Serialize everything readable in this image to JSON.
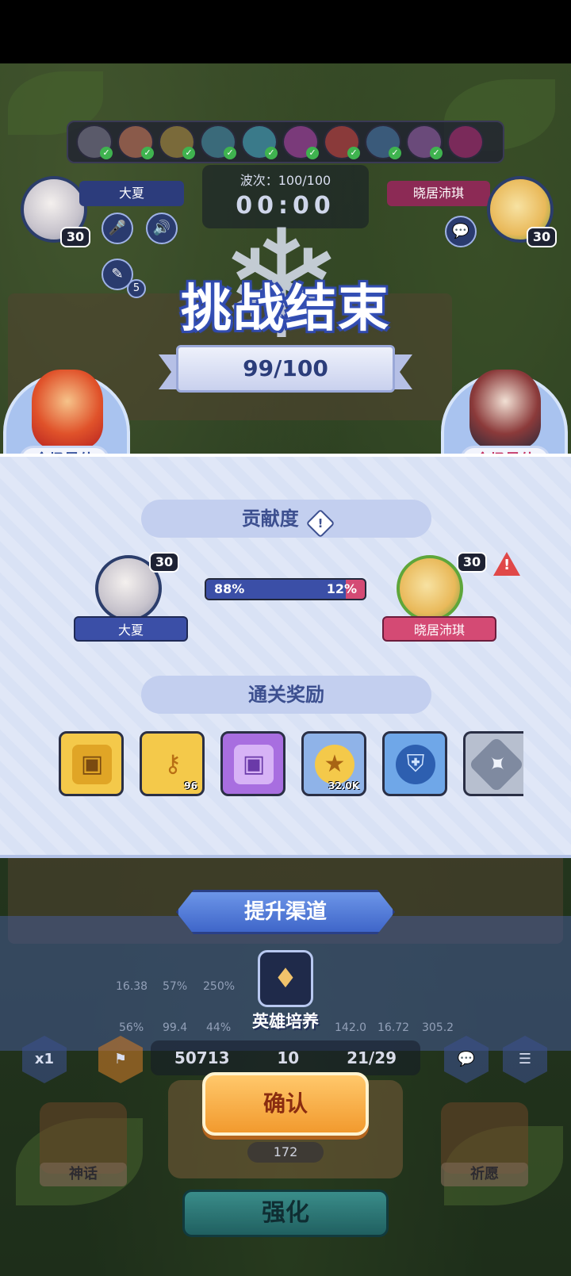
{
  "hud": {
    "player_left": {
      "name": "大夏",
      "level": "30"
    },
    "player_right": {
      "name": "晓居沛琪",
      "level": "30"
    },
    "wave_label": "波次：100/100",
    "timer": "00:00",
    "notes_count": "5"
  },
  "result": {
    "title": "挑战结束",
    "score": "99/100",
    "mvp_left": "全场最佳",
    "mvp_right": "全场最佳"
  },
  "contribution": {
    "header": "贡献度",
    "info_icon": "!",
    "left": {
      "name": "大夏",
      "level": "30",
      "percent_label": "88%",
      "percent": 88
    },
    "right": {
      "name": "晓居沛琪",
      "level": "30",
      "percent_label": "12%",
      "percent": 12
    },
    "warning_icon": "!"
  },
  "rewards": {
    "header": "通关奖励",
    "items": [
      {
        "icon": "gold-chest-icon",
        "qty": ""
      },
      {
        "icon": "key-icon",
        "qty": "96"
      },
      {
        "icon": "purple-chest-icon",
        "qty": ""
      },
      {
        "icon": "gold-coin-icon",
        "qty": "32.0K"
      },
      {
        "icon": "shield-icon",
        "qty": ""
      },
      {
        "icon": "star-crystal-icon",
        "qty": ""
      }
    ]
  },
  "boost": {
    "header": "提升渠道",
    "channel_label": "英雄培养",
    "ghost_stats_top": [
      "16.38",
      "57%",
      "250%"
    ],
    "ghost_stats_bottom": [
      "56%",
      "99.4",
      "44%",
      "142.0",
      "16.72",
      "305.2"
    ]
  },
  "bottom": {
    "speed": "x1",
    "silver": "50713",
    "clover": "10",
    "units": "21/29",
    "confirm": "确认",
    "enhance_cost": "172",
    "strengthen": "强化",
    "myth": "神话",
    "wish": "祈愿"
  },
  "colors": {
    "left_player": "#3b4fa7",
    "right_player": "#d44a74",
    "confirm": "#f29a2e"
  }
}
